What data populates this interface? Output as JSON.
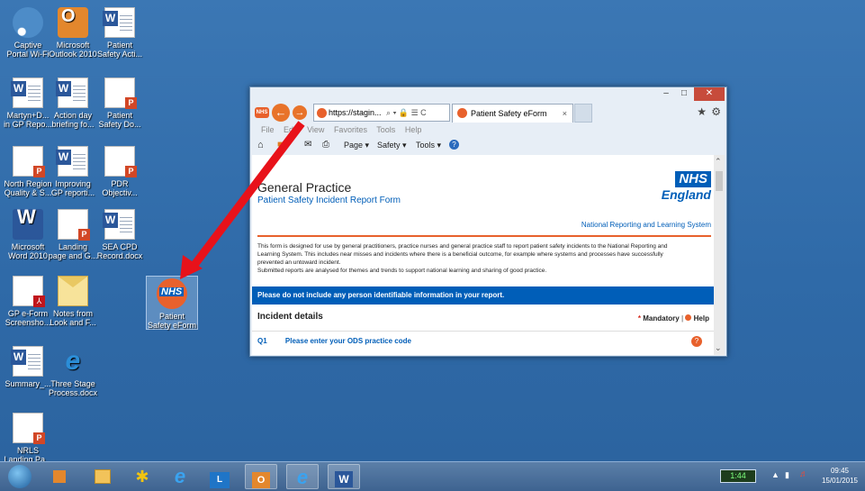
{
  "desktop_icons": [
    {
      "label": "Captive\nPortal Wi-Fi",
      "icon": "wifi-icon"
    },
    {
      "label": "Microsoft\nOutlook 2010",
      "icon": "outlook-icon"
    },
    {
      "label": "Patient\nSafety Acti...",
      "icon": "word-doc-icon"
    },
    {
      "label": "Martyn+D...\nin GP Repo...",
      "icon": "word-doc-icon"
    },
    {
      "label": "Action day\nbriefing fo...",
      "icon": "word-doc-icon"
    },
    {
      "label": "Patient\nSafety Do...",
      "icon": "powerpoint-icon"
    },
    {
      "label": "North Region\nQuality & S...",
      "icon": "powerpoint-icon"
    },
    {
      "label": "Improving\nGP reporti...",
      "icon": "word-doc-icon"
    },
    {
      "label": "PDR\nObjectiv...",
      "icon": "powerpoint-icon"
    },
    {
      "label": "Microsoft\nWord 2010",
      "icon": "word-app-icon"
    },
    {
      "label": "Landing\npage and G...",
      "icon": "powerpoint-icon"
    },
    {
      "label": "SEA CPD\nRecord.docx",
      "icon": "word-doc-icon"
    },
    {
      "label": "GP e-Form\nScreensho...",
      "icon": "pdf-icon"
    },
    {
      "label": "Notes from\nLook and F...",
      "icon": "mail-icon"
    },
    {
      "label": "Patient\nSafety eForm",
      "icon": "nhs-shortcut-icon"
    },
    {
      "label": "Summary_...",
      "icon": "word-doc-icon"
    },
    {
      "label": "Three Stage\nProcess.docx",
      "icon": "internet-explorer-icon"
    },
    {
      "label": "NRLS\nLanding Pa...",
      "icon": "powerpoint-icon"
    }
  ],
  "browser": {
    "url": "https://stagin...",
    "url_controls": "⌕ ▾ 🔒 ☰ C",
    "tab_title": "Patient Safety eForm",
    "menu": [
      "File",
      "Edit",
      "View",
      "Favorites",
      "Tools",
      "Help"
    ],
    "commands": [
      "Page ▾",
      "Safety ▾",
      "Tools ▾"
    ],
    "page": {
      "heading": "General Practice",
      "subheading": "Patient Safety Incident Report Form",
      "logo_top": "NHS",
      "logo_bottom": "England",
      "system_name": "National Reporting and Learning System",
      "intro_1": "This form is designed for use by general practitioners, practice nurses and general practice staff to report patient safety incidents to the National Reporting and Learning System. This includes near misses and incidents where there is a beneficial outcome, for example where systems and processes have successfully prevented an untoward incident.",
      "intro_2": "Submitted reports are analysed for themes and trends to support national learning and sharing of good practice.",
      "warning": "Please do not include any person identifiable information in your report.",
      "section_title": "Incident details",
      "mandatory_label": "Mandatory",
      "help_label": "Help",
      "q1_number": "Q1",
      "q1_text": "Please enter your ODS practice code"
    }
  },
  "taskbar": {
    "battery": "1:44",
    "time": "09:45",
    "date": "15/01/2015"
  },
  "colors": {
    "nhs_blue": "#005eb8",
    "nhs_orange": "#e8612c",
    "arrow_red": "#e8121a"
  }
}
